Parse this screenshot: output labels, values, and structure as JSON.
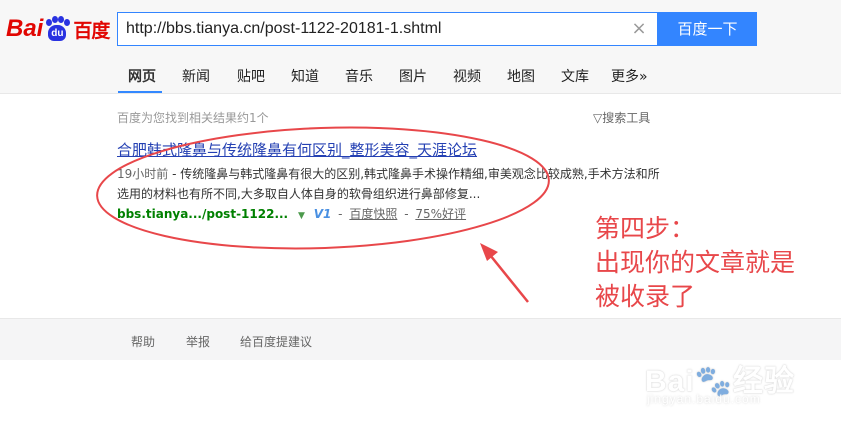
{
  "logo": {
    "text_left": "Bai",
    "text_paw": "du",
    "text_cn": "百度"
  },
  "search": {
    "query": "http://bbs.tianya.cn/post-1122-20181-1.shtml",
    "button_label": "百度一下",
    "clear_symbol": "×"
  },
  "tabs": [
    {
      "label": "网页",
      "active": true
    },
    {
      "label": "新闻"
    },
    {
      "label": "贴吧"
    },
    {
      "label": "知道"
    },
    {
      "label": "音乐"
    },
    {
      "label": "图片"
    },
    {
      "label": "视频"
    },
    {
      "label": "地图"
    },
    {
      "label": "文库"
    },
    {
      "label": "更多»"
    }
  ],
  "results_header": {
    "stats": "百度为您找到相关结果约1个",
    "tools": "▽搜索工具"
  },
  "result": {
    "title": "合肥韩式隆鼻与传统隆鼻有何区别_整形美容_天涯论坛",
    "date": "19小时前",
    "abstract": " - 传统隆鼻与韩式隆鼻有很大的区别,韩式隆鼻手术操作精细,审美观念比较成熟,手术方法和所选用的材料也有所不同,大多取自人体自身的软骨组织进行鼻部修复...",
    "url": "bbs.tianya.../post-1122...",
    "caret": "▼",
    "badge": "V1",
    "separator": "-",
    "cache_label": "百度快照",
    "rating_label": "75%好评"
  },
  "footer": {
    "links": [
      "帮助",
      "举报",
      "给百度提建议"
    ]
  },
  "annotation": {
    "lines": [
      "第四步：",
      "出现你的文章就是",
      "被收录了"
    ],
    "color": "#e8474a"
  },
  "watermark": {
    "main": "Bai",
    "mid": "经验",
    "sub": "jingyan.baidu.com"
  },
  "colors": {
    "accent": "#3385ff",
    "link": "#2440b3",
    "url_green": "#008000",
    "logo_red": "#e10602",
    "logo_blue": "#2932e1"
  }
}
